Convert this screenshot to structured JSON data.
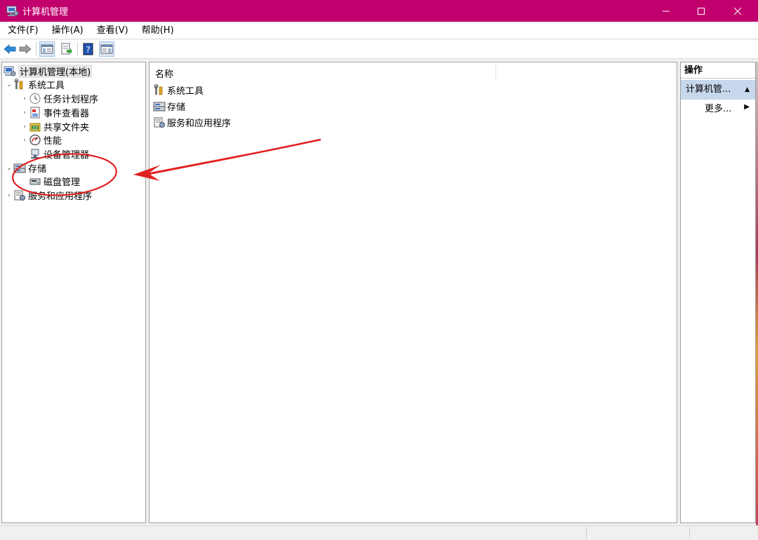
{
  "window": {
    "title": "计算机管理",
    "accent_color": "#c1006e",
    "controls": {
      "minimize": "minimize-icon",
      "maximize": "maximize-icon",
      "close": "close-icon"
    }
  },
  "menu": [
    {
      "label": "文件(F)"
    },
    {
      "label": "操作(A)"
    },
    {
      "label": "查看(V)"
    },
    {
      "label": "帮助(H)"
    }
  ],
  "toolbar": {
    "buttons": [
      "back-icon",
      "forward-icon",
      "show-hide-tree-icon",
      "export-list-icon",
      "help-icon",
      "properties-icon"
    ]
  },
  "tree": {
    "root": {
      "label": "计算机管理(本地)"
    },
    "items": [
      {
        "label": "系统工具",
        "expanded": true
      },
      {
        "label": "任务计划程序"
      },
      {
        "label": "事件查看器"
      },
      {
        "label": "共享文件夹"
      },
      {
        "label": "性能"
      },
      {
        "label": "设备管理器"
      },
      {
        "label": "存储",
        "expanded": true
      },
      {
        "label": "磁盘管理"
      },
      {
        "label": "服务和应用程序"
      }
    ]
  },
  "center": {
    "column_header": "名称",
    "rows": [
      {
        "label": "系统工具"
      },
      {
        "label": "存储"
      },
      {
        "label": "服务和应用程序"
      }
    ]
  },
  "actions": {
    "header": "操作",
    "section": "计算机管...",
    "more": "更多..."
  },
  "annotation": {
    "color": "#e02020"
  }
}
